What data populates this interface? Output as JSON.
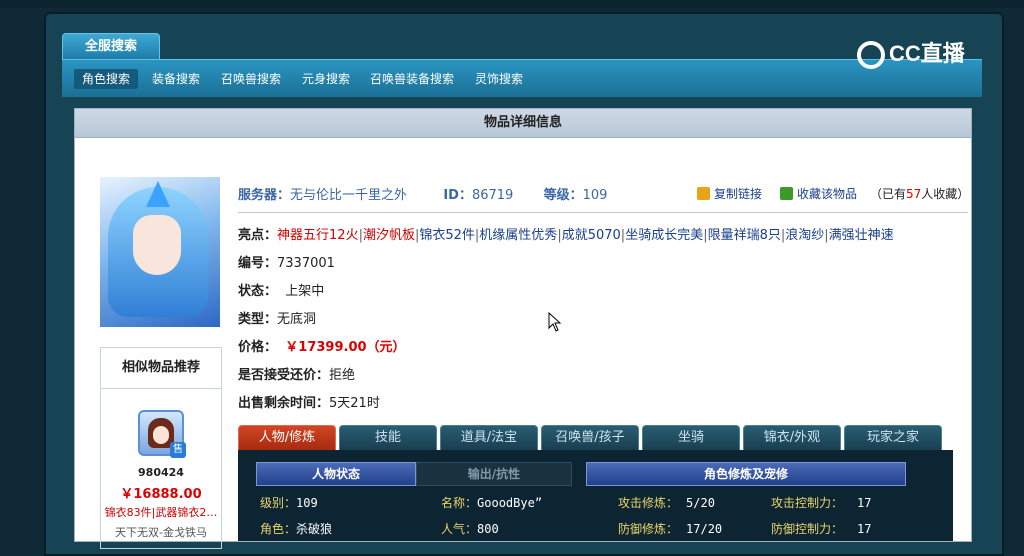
{
  "header": {
    "main_tab": "全服搜索",
    "categories": [
      "角色搜索",
      "装备搜索",
      "召唤兽搜索",
      "元身搜索",
      "召唤兽装备搜索",
      "灵饰搜索"
    ],
    "logo_text": "CC直播"
  },
  "panel": {
    "title": "物品详细信息"
  },
  "item": {
    "server_label": "服务器：",
    "server_value": "无与伦比一千里之外",
    "id_label": "ID：",
    "id_value": "86719",
    "level_label": "等级：",
    "level_value": "109",
    "copy_link": "复制链接",
    "favorite": "收藏该物品",
    "fav_count_prefix": "（已有",
    "fav_count": "57",
    "fav_count_suffix": "人收藏）",
    "highlights_label": "亮点：",
    "highlights": [
      "神器五行12火",
      "潮汐帆板",
      "锦衣52件",
      "机缘属性优秀",
      "成就5070",
      "坐骑成长完美",
      "限量祥瑞8只",
      "浪淘纱",
      "满强壮神速"
    ],
    "number_label": "编号：",
    "number_value": "7337001",
    "status_label": "状态：",
    "status_value": "上架中",
    "type_label": "类型：",
    "type_value": "无底洞",
    "price_label": "价格：",
    "price_value": "￥17399.00（元）",
    "bargain_label": "是否接受还价：",
    "bargain_value": "拒绝",
    "remaining_label": "出售剩余时间：",
    "remaining_value": "5天21时"
  },
  "similar": {
    "title": "相似物品推荐",
    "badge": "售",
    "id": "980424",
    "price": "￥16888.00",
    "desc": "锦衣83件|武器锦衣2…",
    "server": "天下无双-金戈铁马"
  },
  "tabs": [
    "人物/修炼",
    "技能",
    "道具/法宝",
    "召唤兽/孩子",
    "坐骑",
    "锦衣/外观",
    "玩家之家"
  ],
  "detail": {
    "headers": [
      "人物状态",
      "输出/抗性",
      "角色修炼及宠修"
    ],
    "rows": [
      {
        "l1": "级别：",
        "v1": "109",
        "l2": "名称：",
        "v2": "GooodBye”",
        "l3": "攻击修炼：",
        "v3": "5/20",
        "l4": "攻击控制力：",
        "v4": "17"
      },
      {
        "l1": "角色：",
        "v1": "杀破狼",
        "l2": "人气：",
        "v2": "800",
        "l3": "防御修炼：",
        "v3": "17/20",
        "l4": "防御控制力：",
        "v4": "17"
      }
    ]
  }
}
